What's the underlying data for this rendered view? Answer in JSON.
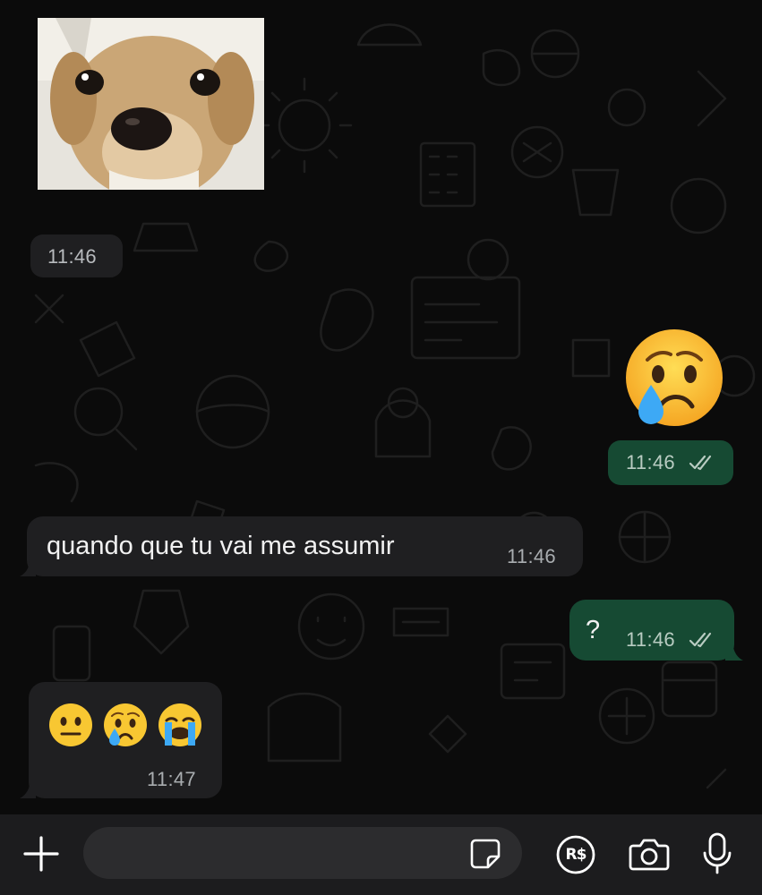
{
  "messages": [
    {
      "id": "m1",
      "direction": "incoming",
      "type": "image",
      "image_subject": "puppy-photo",
      "time": "11:46"
    },
    {
      "id": "m2",
      "direction": "outgoing",
      "type": "emoji",
      "emoji": "😢",
      "emoji_name": "crying-face",
      "time": "11:46",
      "status": "read"
    },
    {
      "id": "m3",
      "direction": "incoming",
      "type": "text",
      "text": "quando que tu vai me assumir",
      "time": "11:46"
    },
    {
      "id": "m4",
      "direction": "outgoing",
      "type": "text",
      "text": "?",
      "time": "11:46",
      "status": "read"
    },
    {
      "id": "m5",
      "direction": "incoming",
      "type": "emoji",
      "emojis": [
        "😐",
        "😢",
        "😭"
      ],
      "emoji_names": [
        "neutral-face",
        "crying-face",
        "loudly-crying-face"
      ],
      "time": "11:47"
    }
  ],
  "composer": {
    "placeholder": "",
    "currency_label": "R$",
    "icons": [
      "plus-icon",
      "sticker-icon",
      "payment-icon",
      "camera-icon",
      "microphone-icon"
    ]
  },
  "colors": {
    "background": "#0b0b0b",
    "incoming_bubble": "#1f1f21",
    "outgoing_bubble": "#164a33",
    "toolbar": "#1c1c1e"
  }
}
